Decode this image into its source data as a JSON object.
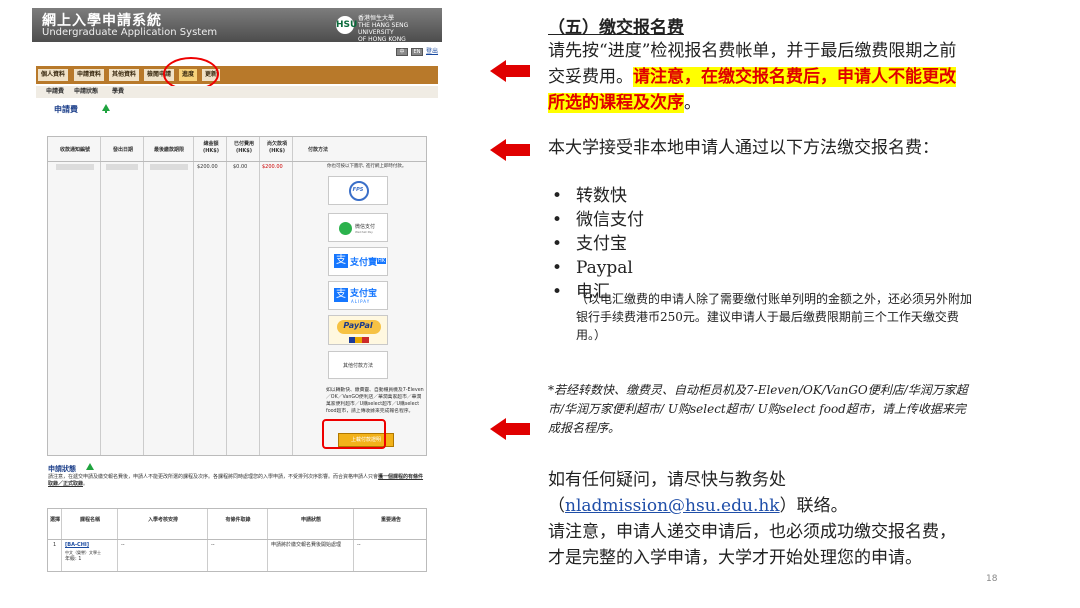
{
  "screenshot": {
    "banner": {
      "title": "網上入學申請系統",
      "subtitle": "Undergraduate Application System",
      "logo_mark": "HSU",
      "university_zh": "香港恒生大學",
      "university_en_1": "THE HANG SENG UNIVERSITY",
      "university_en_2": "OF HONG KONG"
    },
    "toolbar": {
      "btn1": "中",
      "btn2": "EN",
      "link": "登出"
    },
    "tabs": [
      {
        "label": "個人資料"
      },
      {
        "label": "申請資料"
      },
      {
        "label": "其他資料"
      },
      {
        "label": "檢閱申請"
      },
      {
        "label": "進度"
      },
      {
        "label": "更新"
      }
    ],
    "subnav": [
      "申請費",
      "申請狀態",
      "學費"
    ],
    "fee_section_title": "申請費",
    "fee_table": {
      "headers": [
        "收款通知編號",
        "發出日期",
        "最後繳款期限",
        "總金額 (HK$)",
        "已付費用 (HK$)",
        "尚欠款項 (HK$)",
        "付款方法"
      ],
      "row": {
        "total": "$200.00",
        "paid": "$0.00",
        "outstanding": "$200.00"
      },
      "pay_intro": "你也可按以下圖示, 進行網上即時付款。",
      "pay_buttons": [
        "FPS",
        "微信支付",
        "支付寶HK",
        "支付宝",
        "PayPal"
      ],
      "fps_label": "FPS",
      "wechat_label": "微信支付",
      "wechat_sub": "WeChat Pay",
      "alipayhk_label": "支付寶",
      "alipayhk_suffix": "HK",
      "alipay_label": "支付宝",
      "alipay_sub": "ALIPAY",
      "paypal_label": "PayPal",
      "other_methods": "其他付款方法",
      "fps_note": "如以轉數快、繳費靈、自動櫃員機及7-Eleven／OK／VanGO便利店／華潤萬家超市／華潤萬家便利超市／U購select超市／U購select food超市，請上傳收據來完成報名程序。",
      "upload_button": "上載付款證明"
    },
    "status_section_title": "申請狀態",
    "status_note": "請注意，在遞交申請及繳交報名費後，申請人不能更改所選的課程及次序。各課程將同時處理您的入學申請，不受排列次序影響。而合資格申請人只會",
    "status_note_bold": "獲一個課程的有條件取錄／正式取錄",
    "status_note_end": "。",
    "prog_table": {
      "headers": [
        "選擇",
        "課程名稱",
        "入學考核安排",
        "有條件取錄",
        "申請狀態",
        "重要通告"
      ],
      "row": {
        "choice": "1",
        "code": "[BA-CHI]",
        "name": "中文（榮譽）文學士",
        "year": "年級: 1",
        "exam": "--",
        "conditional": "--",
        "status": "申請將於繳交報名費後開始處理",
        "notice": "--"
      }
    }
  },
  "right": {
    "section_title": "（五）缴交报名费",
    "para1_plain": "请先按“进度”检视报名费帐单，并于最后缴费限期之前交妥费用。",
    "para1_highlight": "请注意，在缴交报名费后，申请人不能更改所选的课程及次序",
    "para1_end": "。",
    "para2": "本大学接受非本地申请人通过以下方法缴交报名费：",
    "methods": [
      "转数快",
      "微信支付",
      "支付宝",
      "Paypal",
      "电汇"
    ],
    "tt_note": "（以电汇缴费的申请人除了需要缴付账单列明的金额之外，还必须另外附加银行手续费港币250元。建议申请人于最后缴费限期前三个工作天缴交费用。）",
    "fps_footnote": "*若经转数快、缴费灵、自动柜员机及7-Eleven/OK/VanGO便利店/华润万家超市/华润万家便利超市/ U购select超市/ U购select food超市，请上传收据来完成报名程序。",
    "contact_1": "如有任何疑问，请尽快与教务处",
    "contact_paren_open": "（",
    "contact_email": "nladmission@hsu.edu.hk",
    "contact_paren_close": "）联络。",
    "contact_2": "请注意，申请人递交申请后，也必须成功缴交报名费，才是完整的入学申请，大学才开始处理您的申请。"
  },
  "page_number": "18",
  "colors": {
    "arrow": "#e00000",
    "highlight_bg": "#ffff00",
    "highlight_text": "#e00000",
    "link": "#1f4ea8",
    "tab_bar": "#b8792a"
  }
}
